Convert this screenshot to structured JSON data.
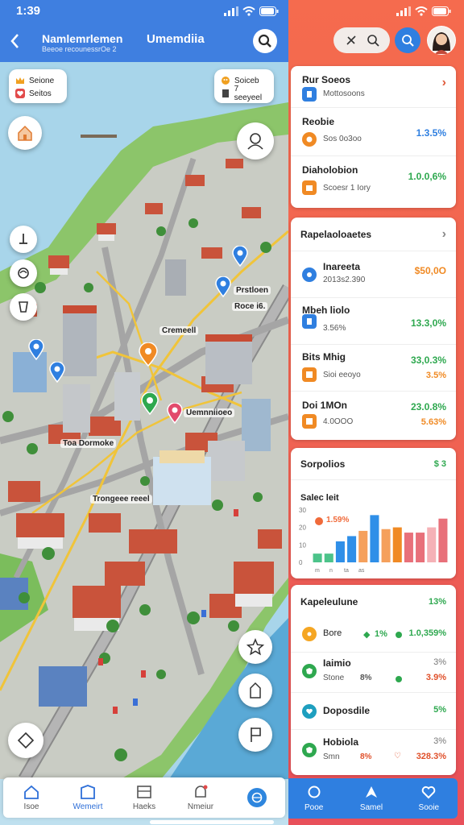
{
  "left": {
    "status": {
      "time": "1:39"
    },
    "header": {
      "back_icon": "chevron-left-icon",
      "title": "Namlemrlemen",
      "subtitle": "Beeoe recounessrOe 2",
      "title_right": "Umemdiia",
      "search_icon": "search-icon"
    },
    "map": {
      "card_left": {
        "line1": "Seione",
        "line2": "Seitos"
      },
      "card_right": {
        "line1": "Soiceb",
        "line2": "7 seeyeel"
      },
      "labels": [
        "Prstloen",
        "Roce i6.",
        "Cremeell",
        "Uemnniioeo",
        "Toa Dormoke",
        "Trongeee reeel"
      ],
      "pins": [
        {
          "color": "#2f7fe0"
        },
        {
          "color": "#2f7fe0"
        },
        {
          "color": "#2f7fe0"
        },
        {
          "color": "#f08a24"
        },
        {
          "color": "#2ea84f"
        },
        {
          "color": "#e24a6c"
        },
        {
          "color": "#2f7fe0"
        }
      ]
    },
    "nav": [
      {
        "label": "Isoe",
        "icon": "home-icon",
        "active": false
      },
      {
        "label": "Wemeirt",
        "icon": "map-icon",
        "active": true
      },
      {
        "label": "Haeks",
        "icon": "list-icon",
        "active": false
      },
      {
        "label": "Nmeiur",
        "icon": "bell-icon",
        "active": false
      },
      {
        "label": "",
        "icon": "globe-icon",
        "active": false
      }
    ]
  },
  "right": {
    "header": {
      "pill_icons": [
        "tools-icon",
        "search-icon"
      ],
      "search_icon": "search-icon",
      "avatar": "avatar"
    },
    "card1": {
      "rows": [
        {
          "name": "Rur Soeos",
          "sub": "Mottosoons",
          "value": "",
          "icon_color": "#2f7fe0",
          "arrow": "›"
        },
        {
          "name": "Reobie",
          "sub": "Sos 0o3oo",
          "value": "1.3.5%",
          "value_color": "#2f7fe0",
          "icon_color": "#f08a24"
        },
        {
          "name": "Diaholobion",
          "sub": "Scoesr 1 Iory",
          "value": "1.0.0,6%",
          "value_color": "#2ea84f",
          "icon_color": "#f08a24"
        }
      ]
    },
    "card2": {
      "title": "Rapelaoloaetes",
      "rows": [
        {
          "name": "Inareeta",
          "sub": "2013s2.390",
          "value": "$50,0O",
          "value_color": "#f08a24",
          "icon_color": "#2f7fe0"
        },
        {
          "name": "Mbeh liolo",
          "sub": "3.56%",
          "value": "13.3,0%",
          "value_color": "#2ea84f",
          "icon_color": "#2f7fe0"
        },
        {
          "name": "Bits Mhig",
          "sub": "Sioi eeoyo",
          "value": "33,0.3%",
          "value2": "3.5%",
          "value_color": "#2ea84f",
          "value2_color": "#f08a24",
          "icon_color": "#f08a24"
        },
        {
          "name": "Doi 1MOn",
          "sub": "4.0OOO",
          "value": "23.0.8%",
          "value2": "5.63%",
          "value_color": "#2ea84f",
          "value2_color": "#f08a24",
          "icon_color": "#f08a24"
        }
      ]
    },
    "card3": {
      "title": "Sorpolios",
      "badge": "$ 3",
      "chart_title": "Salec leit",
      "badge_value": "1.59%",
      "y_ticks": [
        "30",
        "20",
        "10",
        "0"
      ],
      "x_ticks": [
        "m",
        "n",
        "ta",
        "as"
      ]
    },
    "chart_data": {
      "type": "bar",
      "categories": [
        "1",
        "2",
        "3",
        "4",
        "5",
        "6",
        "7",
        "8",
        "9",
        "10",
        "11",
        "12"
      ],
      "values": [
        5,
        5,
        12,
        15,
        18,
        27,
        19,
        20,
        17,
        17,
        20,
        25
      ],
      "colors": [
        "#4cc38a",
        "#4cc38a",
        "#2f8fe8",
        "#2f8fe8",
        "#f5a05c",
        "#2f8fe8",
        "#f5a05c",
        "#f08a24",
        "#e8707a",
        "#e8707a",
        "#f5b1b6",
        "#e8707a"
      ],
      "ylim": [
        0,
        35
      ]
    },
    "card4": {
      "title": "Kapeleulune",
      "badge": "13%",
      "rows": [
        {
          "name": "Bore",
          "sub": "",
          "value": "1.0,359%",
          "value_color": "#2ea84f",
          "icon_color": "#f5a623",
          "mid": "1%",
          "mid_color": "#2ea84f"
        },
        {
          "name": "Iaimio",
          "sub": "Stone",
          "sub2": "8%",
          "value": "3%",
          "value2": "3.9%",
          "value_color": "#555",
          "value2_color": "#e0502a",
          "icon_color": "#2ea84f"
        },
        {
          "name": "Doposdile",
          "sub": "",
          "value": "5%",
          "value_color": "#2ea84f",
          "icon_color": "#1e9fbf"
        },
        {
          "name": "Hobiola",
          "sub": "Smn",
          "sub2": "8%",
          "value": "3%",
          "value2": "328.3%",
          "value_color": "#555",
          "value2_color": "#e0502a",
          "icon_color": "#2ea84f"
        }
      ]
    },
    "nav": [
      {
        "label": "Pooe",
        "icon": "search-icon"
      },
      {
        "label": "Samel",
        "icon": "explore-icon"
      },
      {
        "label": "Sooie",
        "icon": "heart-icon"
      }
    ]
  }
}
